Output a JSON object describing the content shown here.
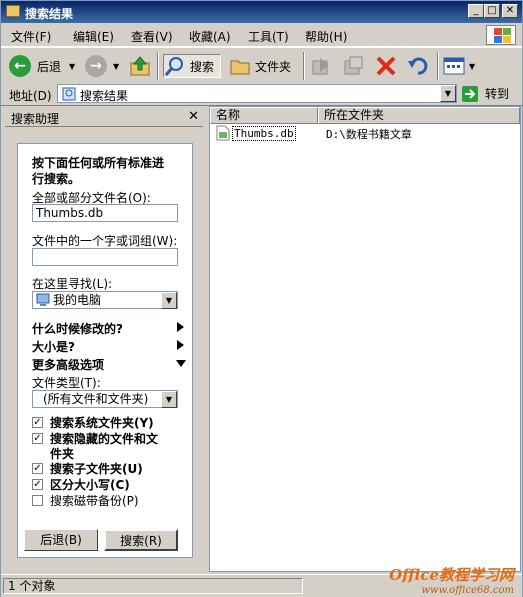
{
  "window": {
    "title": "搜索结果"
  },
  "menu": [
    "文件(F)",
    "编辑(E)",
    "查看(V)",
    "收藏(A)",
    "工具(T)",
    "帮助(H)"
  ],
  "toolbar": {
    "back": "后退",
    "search": "搜索",
    "folders": "文件夹"
  },
  "address": {
    "label": "地址(D)",
    "value": "搜索结果",
    "go": "转到"
  },
  "pane": {
    "title": "搜索助理",
    "heading": "按下面任何或所有标准进行搜索。",
    "heading_line1": "按下面任何或所有标准进",
    "heading_line2": "行搜索。",
    "filename_label": "全部或部分文件名(O):",
    "filename_value": "Thumbs.db",
    "phrase_label": "文件中的一个字或词组(W):",
    "phrase_value": "",
    "lookin_label": "在这里寻找(L):",
    "lookin_value": "我的电脑",
    "when_modified": "什么时候修改的?",
    "size": "大小是?",
    "advanced": "更多高级选项",
    "type_label": "文件类型(T):",
    "type_value": "(所有文件和文件夹)",
    "opt_system": "搜索系统文件夹(Y)",
    "opt_hidden_l1": "搜索隐藏的文件和文",
    "opt_hidden_l2": "件夹",
    "opt_subfolders": "搜索子文件夹(U)",
    "opt_case": "区分大小写(C)",
    "opt_tape": "搜索磁带备份(P)",
    "back_btn": "后退(B)",
    "search_btn": "搜索(R)"
  },
  "list": {
    "columns": [
      "名称",
      "所在文件夹"
    ],
    "rows": [
      {
        "name": "Thumbs.db",
        "folder": "D:\\数程书籍文章"
      }
    ]
  },
  "status": {
    "text": "1 个对象"
  },
  "watermark": {
    "brand": "Office教程学习网",
    "url": "www.office68.com"
  }
}
